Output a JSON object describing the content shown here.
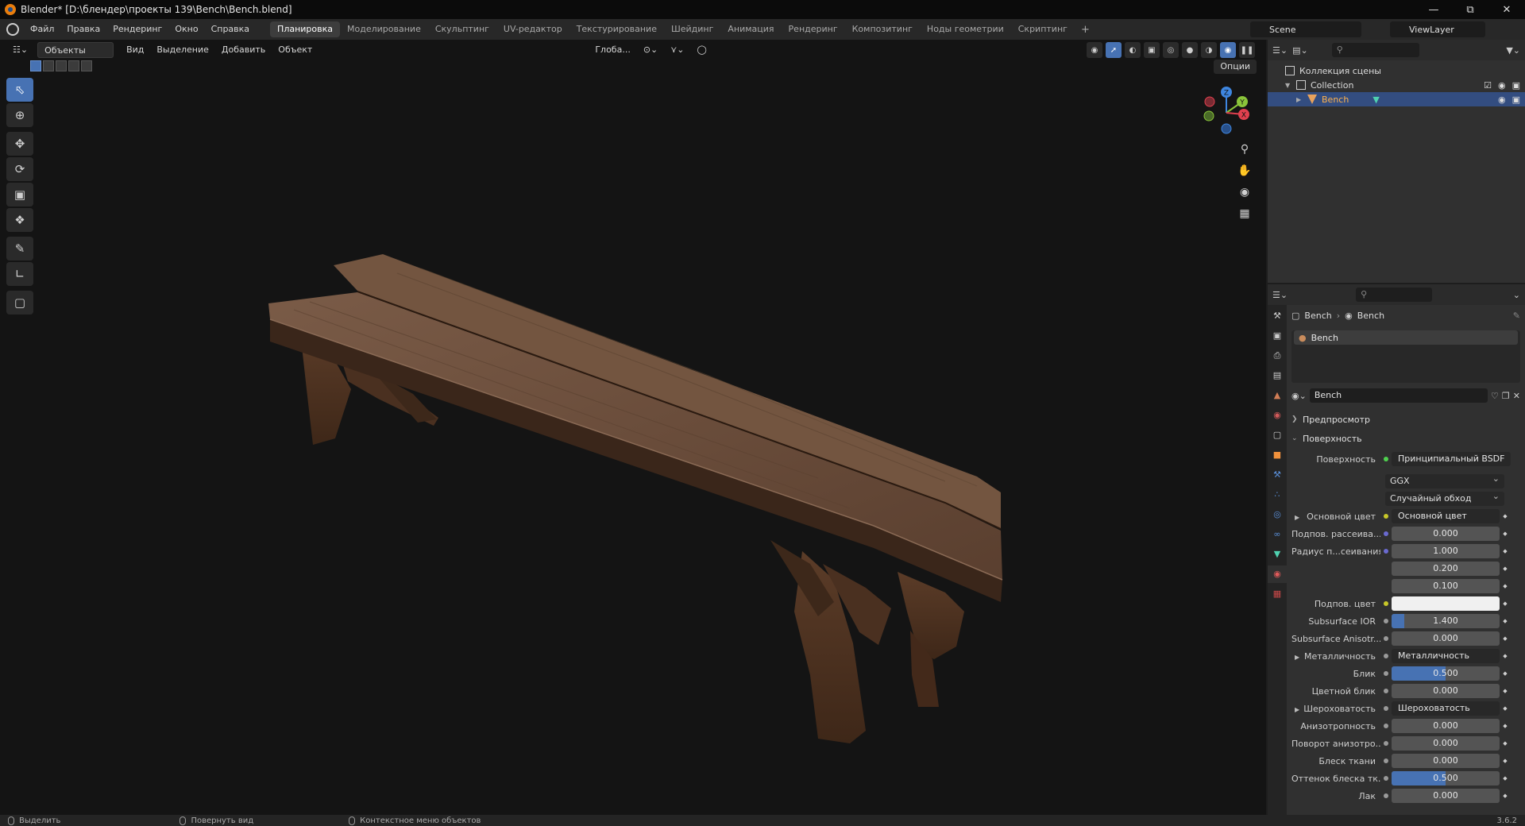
{
  "window": {
    "title": "Blender* [D:\\блендер\\проекты 139\\Bench\\Bench.blend]"
  },
  "menu": [
    "Файл",
    "Правка",
    "Рендеринг",
    "Окно",
    "Справка"
  ],
  "workspaces": [
    "Планировка",
    "Моделирование",
    "Скульптинг",
    "UV-редактор",
    "Текстурирование",
    "Шейдинг",
    "Анимация",
    "Рендеринг",
    "Композитинг",
    "Ноды геометрии",
    "Скриптинг"
  ],
  "workspace_add": "+",
  "scene": "Scene",
  "view_layer": "ViewLayer",
  "viewport": {
    "mode": "Объекты",
    "menus": [
      "Вид",
      "Выделение",
      "Добавить",
      "Объект"
    ],
    "orientation": "Глоба...",
    "options": "Опции",
    "gizmo": {
      "x": "X",
      "y": "Y",
      "z": "Z"
    }
  },
  "outliner": {
    "rows": [
      {
        "label": "Коллекция сцены"
      },
      {
        "label": "Collection"
      },
      {
        "label": "Bench"
      }
    ]
  },
  "properties": {
    "breadcrumb": [
      "Bench",
      "Bench"
    ],
    "slot": "Bench",
    "material_name": "Bench",
    "panels": {
      "preview": "Предпросмотр",
      "surface": "Поверхность"
    },
    "surface_label": "Поверхность",
    "surface_value": "Принципиальный BSDF",
    "distribution": "GGX",
    "subsurface_method": "Случайный обход",
    "rows": [
      {
        "label": "Основной цвет",
        "value": "Основной цвет",
        "kind": "link",
        "tri": true,
        "dot": "#c7c729"
      },
      {
        "label": "Подпов. рассеива...",
        "value": "0.000",
        "kind": "num",
        "dot": "#6a6ad0"
      },
      {
        "label": "Радиус п...сеивания",
        "value": "1.000",
        "kind": "num",
        "dot": "#6a6ad0"
      },
      {
        "label": "",
        "value": "0.200",
        "kind": "num",
        "dot": ""
      },
      {
        "label": "",
        "value": "0.100",
        "kind": "num",
        "dot": ""
      },
      {
        "label": "Подпов. цвет",
        "value": "",
        "kind": "color",
        "dot": "#c7c729"
      },
      {
        "label": "Subsurface IOR",
        "value": "1.400",
        "kind": "num",
        "dot": "#9a9a9a",
        "fill": 0.12
      },
      {
        "label": "Subsurface Anisotr...",
        "value": "0.000",
        "kind": "num",
        "dot": "#9a9a9a"
      },
      {
        "label": "Металличность",
        "value": "Металличность",
        "kind": "link",
        "tri": true,
        "dot": "#9a9a9a"
      },
      {
        "label": "Блик",
        "value": "0.500",
        "kind": "num",
        "dot": "#9a9a9a",
        "fill": 0.5
      },
      {
        "label": "Цветной блик",
        "value": "0.000",
        "kind": "num",
        "dot": "#9a9a9a"
      },
      {
        "label": "Шероховатость",
        "value": "Шероховатость",
        "kind": "link",
        "tri": true,
        "dot": "#9a9a9a"
      },
      {
        "label": "Анизотропность",
        "value": "0.000",
        "kind": "num",
        "dot": "#9a9a9a"
      },
      {
        "label": "Поворот анизотро...",
        "value": "0.000",
        "kind": "num",
        "dot": "#9a9a9a"
      },
      {
        "label": "Блеск ткани",
        "value": "0.000",
        "kind": "num",
        "dot": "#9a9a9a"
      },
      {
        "label": "Оттенок блеска тк...",
        "value": "0.500",
        "kind": "num",
        "dot": "#9a9a9a",
        "fill": 0.5
      },
      {
        "label": "Лак",
        "value": "0.000",
        "kind": "num",
        "dot": "#9a9a9a"
      }
    ]
  },
  "status": {
    "select": "Выделить",
    "rotate": "Повернуть вид",
    "context": "Контекстное меню объектов",
    "version": "3.6.2"
  },
  "colors": {
    "accent": "#4772b3",
    "selected_row": "#334d80",
    "wood_dark": "#4a3426",
    "wood_light": "#6e5241"
  }
}
